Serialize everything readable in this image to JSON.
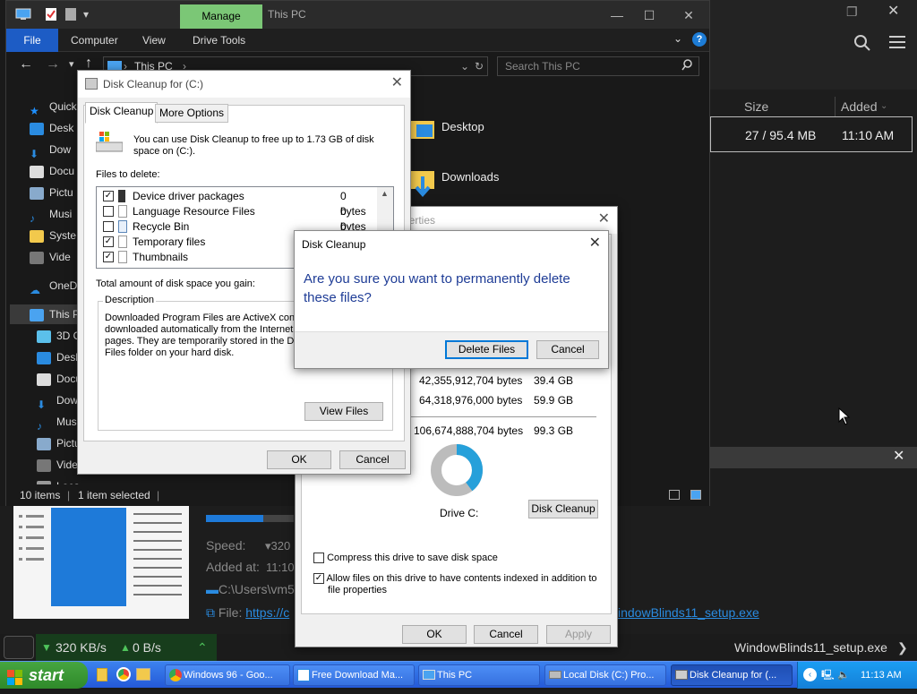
{
  "explorer": {
    "manage_tab": "Manage",
    "title": "This PC",
    "ribbon": {
      "file": "File",
      "tabs": [
        "Computer",
        "View",
        "Drive Tools"
      ]
    },
    "address": "This PC",
    "search_placeholder": "Search This PC",
    "nav": [
      "Quick",
      "Desk",
      "Dow",
      "Docu",
      "Pictu",
      "Musi",
      "Syste",
      "Vide",
      "OneDr",
      "This P",
      "3D O",
      "Desk",
      "Docu",
      "Dow",
      "Musi",
      "Pictu",
      "Vide",
      "Local Disk (C:)"
    ],
    "folders": [
      "Desktop",
      "Downloads"
    ],
    "status": {
      "items": "10 items",
      "selected": "1 item selected"
    }
  },
  "right_panel": {
    "columns": {
      "size": "Size",
      "added": "Added"
    },
    "file_row": {
      "size": "27 / 95.4 MB",
      "added": "11:10 AM"
    }
  },
  "disk_cleanup": {
    "title": "Disk Cleanup for  (C:)",
    "tabs": [
      "Disk Cleanup",
      "More Options"
    ],
    "intro": "You can use Disk Cleanup to free up to 1.73 GB of disk space on  (C:).",
    "files_label": "Files to delete:",
    "files": [
      {
        "name": "Device driver packages",
        "size": "0 bytes",
        "checked": true
      },
      {
        "name": "Language Resource Files",
        "size": "0 bytes",
        "checked": false
      },
      {
        "name": "Recycle Bin",
        "size": "0 bytes",
        "checked": false
      },
      {
        "name": "Temporary files",
        "size": "",
        "checked": true
      },
      {
        "name": "Thumbnails",
        "size": "",
        "checked": true
      }
    ],
    "total_label": "Total amount of disk space you gain:",
    "desc_label": "Description",
    "desc_lines": [
      "Downloaded Program Files are ActiveX contr",
      "downloaded automatically from the Internet w",
      "pages. They are temporarily stored in the Dow",
      "Files folder on your hard disk."
    ],
    "view_files": "View Files",
    "ok": "OK",
    "cancel": "Cancel"
  },
  "properties": {
    "title": "perties",
    "rows": [
      {
        "bytes": "42,355,912,704 bytes",
        "gb": "39.4 GB"
      },
      {
        "bytes": "64,318,976,000 bytes",
        "gb": "59.9 GB"
      },
      {
        "bytes": "106,674,888,704 bytes",
        "gb": "99.3 GB"
      }
    ],
    "used_fraction": 0.397,
    "drive_label": "Drive C:",
    "disk_cleanup_btn": "Disk Cleanup",
    "compress": "Compress this drive to save disk space",
    "index_line1": "Allow files on this drive to have contents indexed in addition to",
    "index_line2": "file properties",
    "ok": "OK",
    "cancel": "Cancel",
    "apply": "Apply"
  },
  "confirm": {
    "title": "Disk Cleanup",
    "line1": "Are you sure you want to permanently delete",
    "line2": "these files?",
    "delete": "Delete Files",
    "cancel": "Cancel"
  },
  "download": {
    "speed_label": "Speed:",
    "speed_value": "▾320",
    "added_label": "Added at:",
    "added_value": "11:10",
    "path": "C:\\Users\\vm5",
    "file_label": "File:",
    "file_link": "https://c",
    "file_name_link": "indowBlinds11_setup.exe",
    "down_rate": "320 KB/s",
    "up_rate": "0 B/s",
    "filename": "WindowBlinds11_setup.exe"
  },
  "taskbar": {
    "start": "start",
    "tasks": [
      "Windows 96 - Goo...",
      "Free Download Ma...",
      "This PC",
      "Local Disk (C:) Pro...",
      "Disk Cleanup for  (..."
    ],
    "clock": "11:13 AM"
  },
  "colors": {
    "accent": "#0078d7",
    "manage": "#7bc776",
    "file_tab": "#1d5cc5",
    "donut_used": "#26a0da",
    "donut_free": "#bcbcbc"
  }
}
